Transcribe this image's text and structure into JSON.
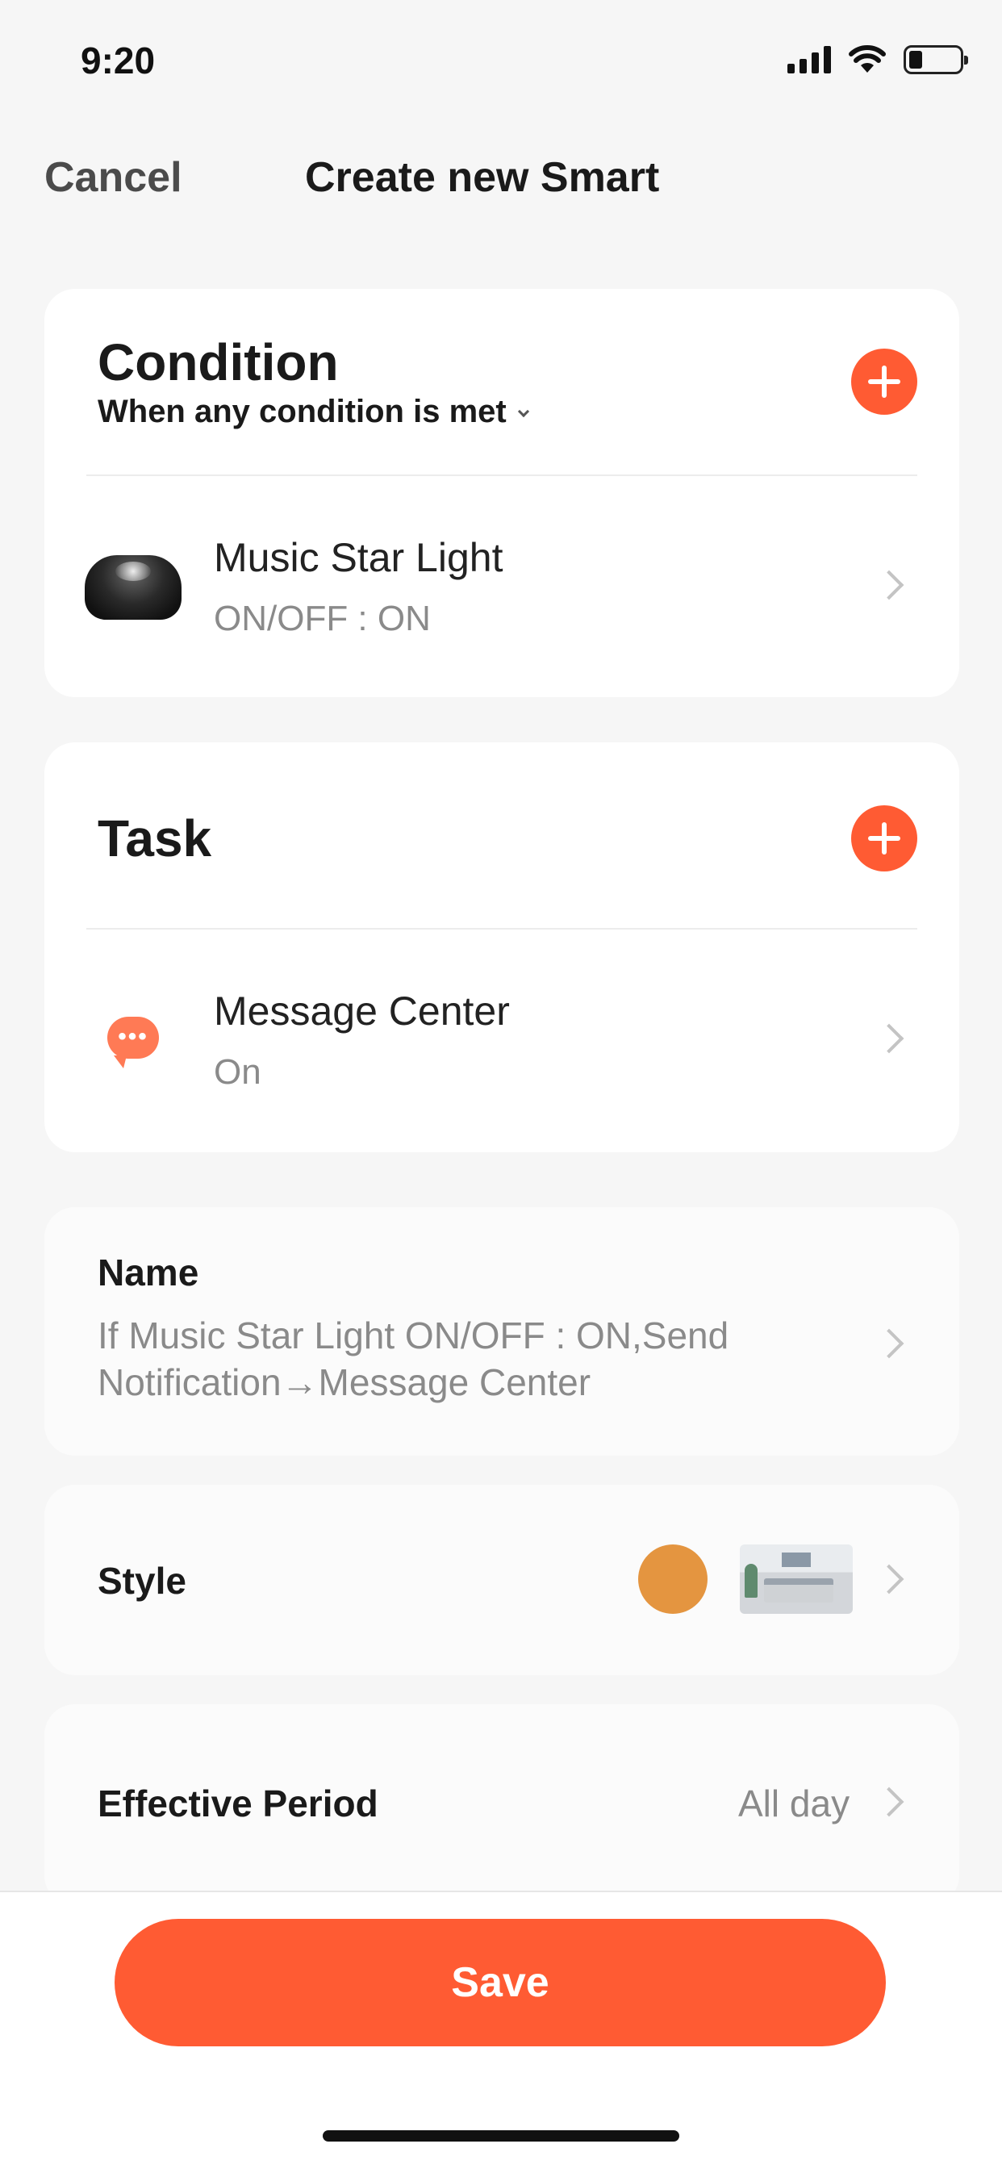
{
  "status_bar": {
    "time": "9:20"
  },
  "header": {
    "cancel_label": "Cancel",
    "title": "Create new Smart"
  },
  "condition": {
    "heading": "Condition",
    "mode_label": "When any condition is met",
    "items": [
      {
        "title": "Music Star Light",
        "subtitle": "ON/OFF : ON",
        "icon": "star-projector-light"
      }
    ]
  },
  "task": {
    "heading": "Task",
    "items": [
      {
        "title": "Message Center",
        "subtitle": "On",
        "icon": "message-bubble-icon"
      }
    ]
  },
  "name": {
    "label": "Name",
    "value": "If Music Star Light ON/OFF : ON,Send Notification→Message Center"
  },
  "style": {
    "label": "Style",
    "color": "#e49540"
  },
  "effective_period": {
    "label": "Effective Period",
    "value": "All day"
  },
  "footer": {
    "save_label": "Save"
  },
  "colors": {
    "accent": "#ff5b33",
    "background": "#f6f6f6",
    "card": "#ffffff"
  }
}
